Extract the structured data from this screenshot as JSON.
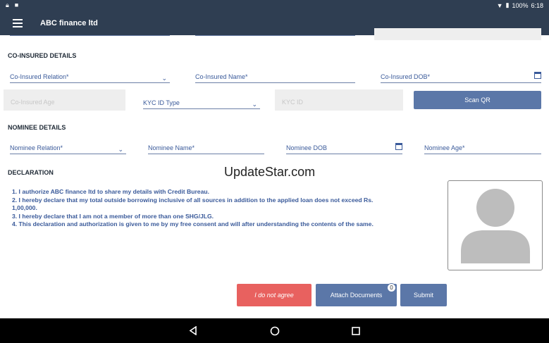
{
  "status": {
    "battery": "100%",
    "time": "6:18"
  },
  "app": {
    "title": "ABC finance ltd"
  },
  "coinsured": {
    "heading": "CO-INSURED DETAILS",
    "relation": "Co-Insured Relation*",
    "name": "Co-Insured Name*",
    "dob": "Co-Insured DOB*",
    "age": "Co-Insured Age",
    "kyc_type": "KYC ID Type",
    "kyc_id": "KYC ID",
    "scan_qr": "Scan QR"
  },
  "nominee": {
    "heading": "NOMINEE DETAILS",
    "relation": "Nominee Relation*",
    "name": "Nominee Name*",
    "dob": "Nominee DOB",
    "age": "Nominee Age*"
  },
  "declaration": {
    "heading": "DECLARATION",
    "lines": [
      "1. I authorize ABC finance ltd to share my details with Credit Bureau.",
      "2. I hereby declare that my total outside borrowing inclusive of all sources in addition to the applied loan does not exceed Rs.",
      "1,00,000.",
      "3. I hereby declare that I am not a member of more than one SHG/JLG.",
      "4. This declaration and authorization is given to me by my free consent and will after understanding the contents of the same."
    ]
  },
  "watermark": "UpdateStar.com",
  "actions": {
    "disagree": "I do not agree",
    "attach": "Attach Documents",
    "attach_count": "0",
    "submit": "Submit"
  },
  "colors": {
    "bar": "#2f3e52",
    "accent": "#5b77a8",
    "danger": "#e8615f"
  }
}
